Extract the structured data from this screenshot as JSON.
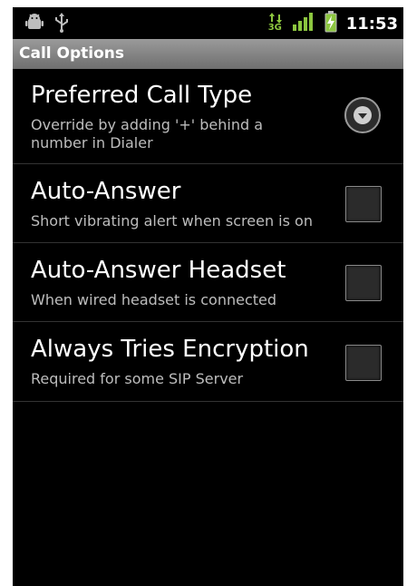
{
  "status_bar": {
    "time": "11:53",
    "network_type": "3G",
    "left_icons": [
      "android-debug-icon",
      "usb-icon"
    ],
    "right_icons": [
      "data-arrows-icon",
      "signal-bars-icon",
      "battery-charging-icon"
    ],
    "accent": "#8cc63f"
  },
  "title_bar": {
    "title": "Call Options"
  },
  "preferences": [
    {
      "title": "Preferred Call Type",
      "summary": "Override by adding '+' behind a number in Dialer",
      "widget": "dropdown"
    },
    {
      "title": "Auto-Answer",
      "summary": "Short vibrating alert when screen is on",
      "widget": "checkbox",
      "checked": false
    },
    {
      "title": "Auto-Answer Headset",
      "summary": "When wired headset is connected",
      "widget": "checkbox",
      "checked": false
    },
    {
      "title": "Always Tries Encryption",
      "summary": "Required for some SIP Server",
      "widget": "checkbox",
      "checked": false
    }
  ]
}
